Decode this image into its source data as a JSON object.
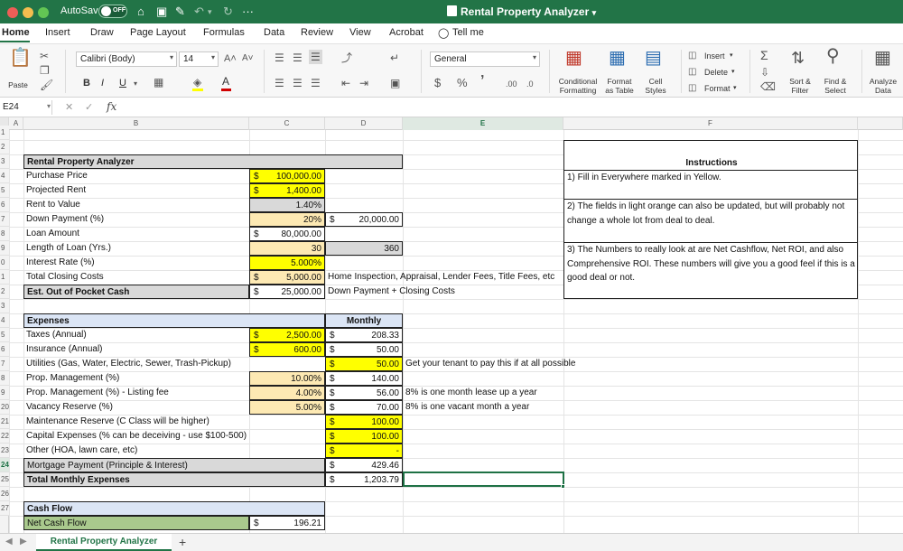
{
  "app": {
    "autosave_label": "AutoSave",
    "autosave_state": "OFF",
    "document_title": "Rental Property Analyzer",
    "more": "···"
  },
  "tabs": [
    "Home",
    "Insert",
    "Draw",
    "Page Layout",
    "Formulas",
    "Data",
    "Review",
    "View",
    "Acrobat",
    "Tell me"
  ],
  "ribbon": {
    "paste": "Paste",
    "font_name": "Calibri (Body)",
    "font_size": "14",
    "grow_font": "A˄",
    "shrink_font": "A˅",
    "bold": "B",
    "italic": "I",
    "underline": "U",
    "number_format": "General",
    "currency": "$",
    "percent": "%",
    "comma": "’",
    "conditional_formatting": [
      "Conditional",
      "Formatting"
    ],
    "format_as_table": [
      "Format",
      "as Table"
    ],
    "cell_styles": [
      "Cell",
      "Styles"
    ],
    "insert": "Insert",
    "delete": "Delete",
    "format": "Format",
    "sort_filter": [
      "Sort &",
      "Filter"
    ],
    "find_select": [
      "Find &",
      "Select"
    ],
    "analyze_data": [
      "Analyze",
      "Data"
    ]
  },
  "formula_bar": {
    "name_box": "E24",
    "fx": "fx",
    "cancel": "✕",
    "confirm": "✓"
  },
  "columns": [
    "A",
    "B",
    "C",
    "D",
    "E",
    "F"
  ],
  "rows": [
    "1",
    "2",
    "3",
    "4",
    "5",
    "6",
    "7",
    "8",
    "9",
    "0",
    "1",
    "2",
    "3",
    "4",
    "5",
    "6",
    "7",
    "8",
    "9",
    "20",
    "21",
    "22",
    "23",
    "24",
    "25",
    "26",
    "27"
  ],
  "sheet": {
    "title": "Rental Property Analyzer",
    "purchase_price": {
      "label": "Purchase Price",
      "value": "100,000.00"
    },
    "projected_rent": {
      "label": "Projected Rent",
      "value": "1,400.00"
    },
    "rent_to_value": {
      "label": "Rent to Value",
      "value": "1.40%"
    },
    "down_payment": {
      "label": "Down Payment (%)",
      "value": "20%",
      "amount": "20,000.00"
    },
    "loan_amount": {
      "label": "Loan Amount",
      "value": "80,000.00"
    },
    "loan_length": {
      "label": "Length of Loan (Yrs.)",
      "value": "30",
      "months": "360"
    },
    "interest_rate": {
      "label": "Interest Rate (%)",
      "value": "5.000%"
    },
    "closing_costs": {
      "label": "Total Closing Costs",
      "value": "5,000.00",
      "note": "Home Inspection, Appraisal, Lender Fees, Title Fees, etc"
    },
    "out_of_pocket": {
      "label": "Est. Out of Pocket Cash",
      "value": "25,000.00",
      "note": "Down Payment + Closing Costs"
    },
    "expenses_header": "Expenses",
    "monthly_header": "Monthly",
    "taxes": {
      "label": "Taxes (Annual)",
      "value": "2,500.00",
      "monthly": "208.33"
    },
    "insurance": {
      "label": "Insurance (Annual)",
      "value": "600.00",
      "monthly": "50.00"
    },
    "utilities": {
      "label": "Utilities (Gas, Water, Electric, Sewer, Trash-Pickup)",
      "monthly": "50.00",
      "note": "Get your tenant to pay this if at all possible"
    },
    "prop_mgmt": {
      "label": "Prop. Management (%)",
      "value": "10.00%",
      "monthly": "140.00"
    },
    "prop_mgmt_listing": {
      "label": "Prop. Management (%) - Listing fee",
      "value": "4.00%",
      "monthly": "56.00",
      "note": "8% is one month lease up a year"
    },
    "vacancy": {
      "label": "Vacancy Reserve (%)",
      "value": "5.00%",
      "monthly": "70.00",
      "note": "8% is one vacant month a year"
    },
    "maintenance": {
      "label": "Maintenance Reserve (C Class will be higher)",
      "monthly": "100.00"
    },
    "capex": {
      "label": "Capital Expenses (% can be deceiving - use $100-500)",
      "monthly": "100.00"
    },
    "other": {
      "label": "Other (HOA, lawn care, etc)",
      "monthly": "-"
    },
    "mortgage": {
      "label": "Mortgage Payment (Principle & Interest)",
      "monthly": "429.46"
    },
    "total_monthly": {
      "label": "Total Monthly Expenses",
      "monthly": "1,203.79"
    },
    "cash_flow_header": "Cash Flow",
    "net_cash_flow": {
      "label": "Net Cash Flow",
      "value": "196.21"
    },
    "currency_symbol": "$"
  },
  "instructions": {
    "title": "Instructions",
    "step1": "1) Fill in Everywhere marked in Yellow.",
    "step2": "2) The fields in light orange can also be updated, but will probably not change a whole lot from deal to deal.",
    "step3": "3) The Numbers to really look at are Net Cashflow, Net ROI, and also Comprehensive ROI. These numbers will give you a good feel if this is a good deal or not."
  },
  "sheet_tabs": {
    "active": "Rental Property Analyzer",
    "add": "+"
  },
  "colors": {
    "excel_green": "#227447",
    "input_yellow": "#ffff00",
    "light_orange": "#fde9b3",
    "header_gray": "#d9d9d9",
    "expenses_blue": "#dbe5f5",
    "cashflow_green": "#a9c98d"
  }
}
